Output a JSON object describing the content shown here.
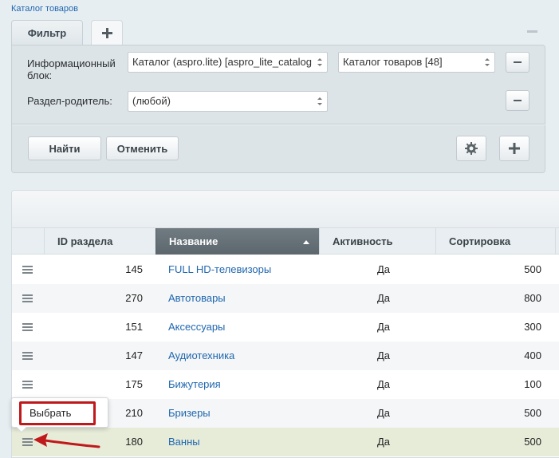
{
  "breadcrumb": "Каталог товаров",
  "filter": {
    "tab_label": "Фильтр",
    "fields": [
      {
        "label": "Информационный блок:",
        "select1": "Каталог (aspro.lite) [aspro_lite_catalog",
        "select2": "Каталог товаров [48]"
      },
      {
        "label": "Раздел-родитель:",
        "select1": "(любой)"
      }
    ],
    "find_label": "Найти",
    "cancel_label": "Отменить"
  },
  "table": {
    "columns": [
      "ID раздела",
      "Название",
      "Активность",
      "Сортировка"
    ],
    "sorted_column": "Название",
    "rows": [
      {
        "id": "145",
        "name": "FULL HD-телевизоры",
        "active": "Да",
        "sort": "500"
      },
      {
        "id": "270",
        "name": "Автотовары",
        "active": "Да",
        "sort": "800"
      },
      {
        "id": "151",
        "name": "Аксессуары",
        "active": "Да",
        "sort": "300"
      },
      {
        "id": "147",
        "name": "Аудиотехника",
        "active": "Да",
        "sort": "400"
      },
      {
        "id": "175",
        "name": "Бижутерия",
        "active": "Да",
        "sort": "100"
      },
      {
        "id": "210",
        "name": "Бризеры",
        "active": "Да",
        "sort": "500"
      },
      {
        "id": "180",
        "name": "Ванны",
        "active": "Да",
        "sort": "500"
      }
    ]
  },
  "context_menu": {
    "item": "Выбрать"
  },
  "colors": {
    "accent_link": "#2067b0",
    "highlight_red": "#c0191b",
    "selected_row": "#e7ecd9"
  }
}
